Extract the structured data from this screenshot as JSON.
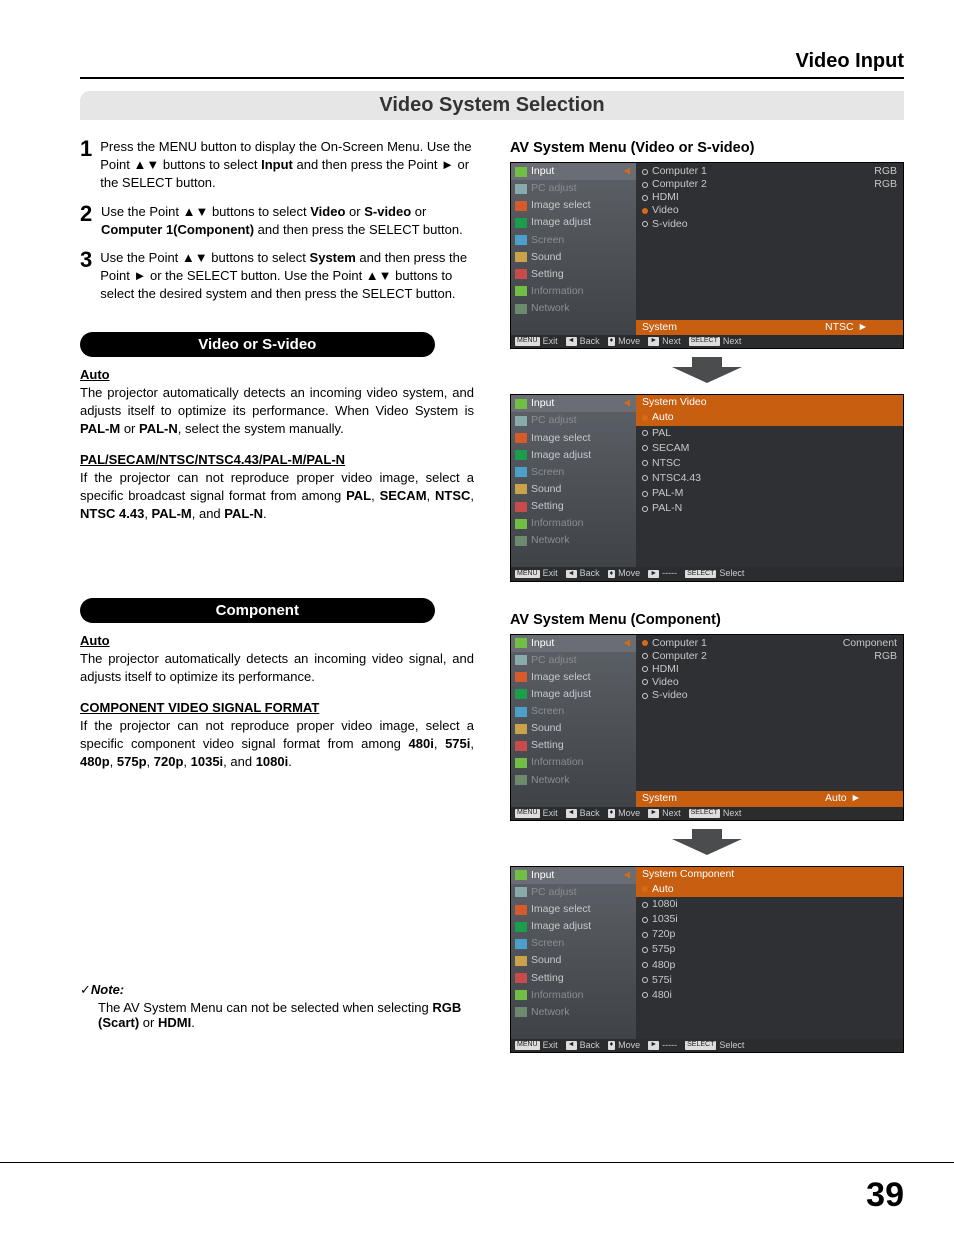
{
  "header": "Video Input",
  "section_title": "Video System Selection",
  "steps": [
    {
      "num": "1",
      "parts": [
        "Press the MENU button to display the On-Screen Menu. Use the Point ▲▼ buttons to select ",
        {
          "b": "Input"
        },
        " and then press the Point ► or the SELECT button."
      ]
    },
    {
      "num": "2",
      "parts": [
        "Use the Point ▲▼ buttons to select ",
        {
          "b": "Video"
        },
        " or ",
        {
          "b": "S-video"
        },
        " or ",
        {
          "b": "Computer 1(Component)"
        },
        " and then press the SELECT button."
      ]
    },
    {
      "num": "3",
      "parts": [
        "Use the Point ▲▼ buttons to select ",
        {
          "b": "System"
        },
        " and then press the Point ► or the SELECT button. Use the Point ▲▼ buttons to select the desired system and then press the SELECT button."
      ]
    }
  ],
  "pill1": "Video or S-video",
  "sec1": {
    "auto_h": "Auto",
    "auto_p_parts": [
      "The projector automatically detects an incoming video system, and adjusts itself to optimize its performance. When Video System is ",
      {
        "b": "PAL-M"
      },
      " or ",
      {
        "b": "PAL-N"
      },
      ", select the system manually."
    ],
    "fmt_h": "PAL/SECAM/NTSC/NTSC4.43/PAL-M/PAL-N",
    "fmt_p_parts": [
      "If the projector can not reproduce proper video image, select a specific broadcast signal format from among ",
      {
        "b": "PAL"
      },
      ", ",
      {
        "b": "SECAM"
      },
      ", ",
      {
        "b": "NTSC"
      },
      ", ",
      {
        "b": "NTSC 4.43"
      },
      ", ",
      {
        "b": "PAL-M"
      },
      ", and ",
      {
        "b": "PAL-N"
      },
      "."
    ]
  },
  "pill2": "Component",
  "sec2": {
    "auto_h": "Auto",
    "auto_p": "The projector automatically detects an incoming video signal, and adjusts itself to optimize its performance.",
    "fmt_h": "COMPONENT VIDEO SIGNAL FORMAT",
    "fmt_p_parts": [
      "If the projector can not reproduce proper video image, select a specific component video signal format from among ",
      {
        "b": "480i"
      },
      ", ",
      {
        "b": "575i"
      },
      ", ",
      {
        "b": "480p"
      },
      ", ",
      {
        "b": "575p"
      },
      ", ",
      {
        "b": "720p"
      },
      ", ",
      {
        "b": "1035i"
      },
      ", and ",
      {
        "b": "1080i"
      },
      "."
    ]
  },
  "note_lbl": "Note:",
  "note_p_parts": [
    "The AV System Menu can not be selected when selecting ",
    {
      "b": "RGB (Scart)"
    },
    " or ",
    {
      "b": "HDMI"
    },
    "."
  ],
  "osd_side": [
    {
      "label": "Input",
      "ico": "#6fbf44",
      "hl": true
    },
    {
      "label": "PC adjust",
      "ico": "#8aa",
      "muted": true
    },
    {
      "label": "Image select",
      "ico": "#d85a2a"
    },
    {
      "label": "Image adjust",
      "ico": "#1a9e4b"
    },
    {
      "label": "Screen",
      "ico": "#4aa0c9",
      "muted": true
    },
    {
      "label": "Sound",
      "ico": "#caa24a"
    },
    {
      "label": "Setting",
      "ico": "#c94a4a"
    },
    {
      "label": "Information",
      "ico": "#6fbf44",
      "muted": true
    },
    {
      "label": "Network",
      "ico": "#6c8a6c",
      "muted": true
    }
  ],
  "osd1": {
    "title": "AV System Menu (Video or S-video)",
    "inputs": [
      {
        "name": "Computer 1",
        "right": "RGB",
        "sel": false
      },
      {
        "name": "Computer 2",
        "right": "RGB",
        "sel": false
      },
      {
        "name": "HDMI",
        "right": "",
        "sel": false
      },
      {
        "name": "Video",
        "right": "",
        "sel": true
      },
      {
        "name": "S-video",
        "right": "",
        "sel": false
      }
    ],
    "sys_label": "System",
    "sys_val": "NTSC",
    "foot": [
      "Exit",
      "Back",
      "Move",
      "Next",
      "Next"
    ],
    "foot_k": [
      "MENU",
      "◄",
      "♦",
      "►",
      "SELECT"
    ]
  },
  "osd2": {
    "hdr": "System   Video",
    "items": [
      {
        "name": "Auto",
        "sel": true
      },
      {
        "name": "PAL"
      },
      {
        "name": "SECAM"
      },
      {
        "name": "NTSC"
      },
      {
        "name": "NTSC4.43"
      },
      {
        "name": "PAL-M"
      },
      {
        "name": "PAL-N"
      }
    ],
    "foot": [
      "Exit",
      "Back",
      "Move",
      "-----",
      "Select"
    ],
    "foot_k": [
      "MENU",
      "◄",
      "♦",
      "►",
      "SELECT"
    ]
  },
  "osd3": {
    "title": "AV System Menu (Component)",
    "inputs": [
      {
        "name": "Computer 1",
        "right": "Component",
        "sel": true
      },
      {
        "name": "Computer 2",
        "right": "RGB",
        "sel": false
      },
      {
        "name": "HDMI",
        "right": "",
        "sel": false
      },
      {
        "name": "Video",
        "right": "",
        "sel": false
      },
      {
        "name": "S-video",
        "right": "",
        "sel": false
      }
    ],
    "sys_label": "System",
    "sys_val": "Auto",
    "foot": [
      "Exit",
      "Back",
      "Move",
      "Next",
      "Next"
    ],
    "foot_k": [
      "MENU",
      "◄",
      "♦",
      "►",
      "SELECT"
    ]
  },
  "osd4": {
    "hdr": "System   Component",
    "items": [
      {
        "name": "Auto",
        "sel": true
      },
      {
        "name": "1080i"
      },
      {
        "name": "1035i"
      },
      {
        "name": "720p"
      },
      {
        "name": "575p"
      },
      {
        "name": "480p"
      },
      {
        "name": "575i"
      },
      {
        "name": "480i"
      }
    ],
    "foot": [
      "Exit",
      "Back",
      "Move",
      "-----",
      "Select"
    ],
    "foot_k": [
      "MENU",
      "◄",
      "♦",
      "►",
      "SELECT"
    ]
  },
  "page_num": "39"
}
